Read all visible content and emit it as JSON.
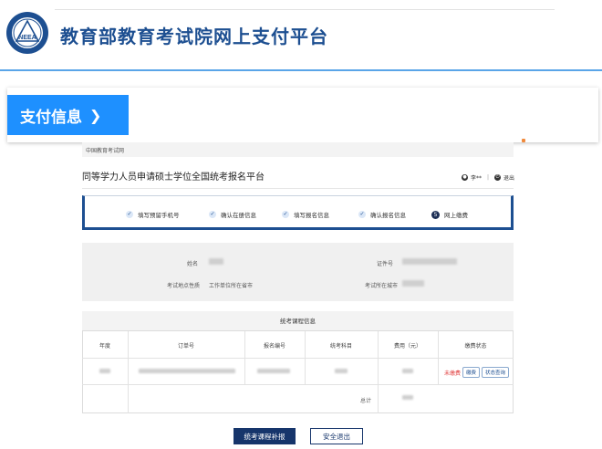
{
  "header": {
    "title": "教育部教育考试院网上支付平台",
    "logo_icon": "neea-seal-logo"
  },
  "pay_tab": {
    "label": "支付信息",
    "chevron": "❯"
  },
  "portal": {
    "breadcrumb": "中国教育考试网",
    "title": "同等学力人员申请硕士学位全国统考报名平台",
    "user_name": "李**",
    "logout": "退出",
    "steps": [
      {
        "label": "填写预留手机号",
        "state": "done"
      },
      {
        "label": "确认在册信息",
        "state": "done"
      },
      {
        "label": "填写报名信息",
        "state": "done"
      },
      {
        "label": "确认报名信息",
        "state": "done"
      },
      {
        "label": "网上缴费",
        "state": "current",
        "num": "5"
      }
    ]
  },
  "info": {
    "name_label": "姓名",
    "id_label": "证件号",
    "site_label": "考试地点性质",
    "site_value": "工作单位所在省市",
    "city_label": "考试所在城市"
  },
  "table": {
    "title": "统考课程信息",
    "columns": [
      "年度",
      "订单号",
      "报名编号",
      "统考科目",
      "费用（元）",
      "缴费状态"
    ],
    "status": "未缴费",
    "pay_button": "缴费",
    "query_button": "状态查询",
    "total_label": "总计"
  },
  "buttons": {
    "supplement": "统考课程补报",
    "safe_exit": "安全退出"
  },
  "colors": {
    "brand_blue": "#1d4f91",
    "tab_blue": "#1e90ff",
    "unpaid_red": "#e03b3b",
    "dark_navy": "#16356b"
  }
}
